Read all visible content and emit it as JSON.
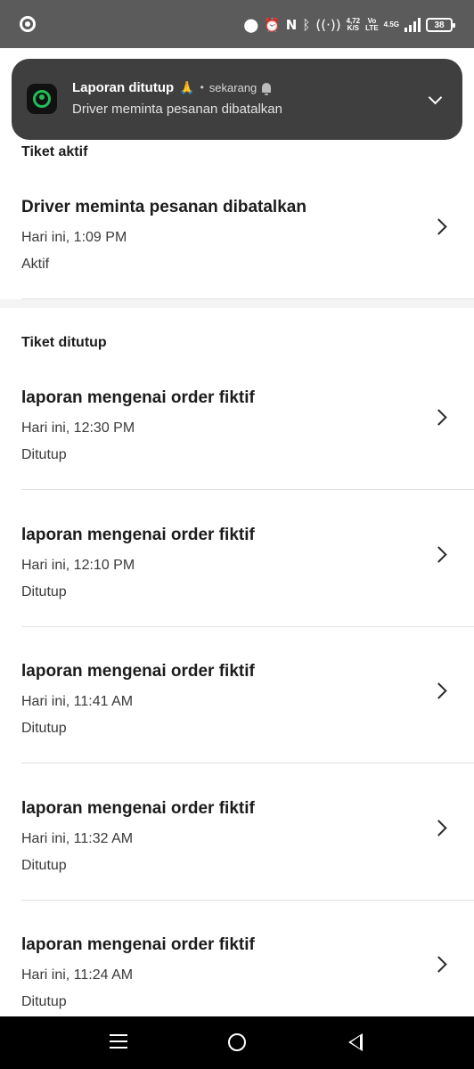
{
  "status_bar": {
    "net_speed_value": "4,72",
    "net_speed_unit": "K/S",
    "volte_top": "Vo",
    "volte_bottom": "LTE",
    "network_type": "4.5G",
    "battery_level": "38",
    "icons": [
      "location-icon",
      "alarm-icon",
      "nfc-icon",
      "bluetooth-icon",
      "hotspot-icon",
      "signal-icon",
      "battery-icon"
    ]
  },
  "notification": {
    "title": "Laporan ditutup",
    "emoji": "🙏",
    "separator": "•",
    "time": "sekarang",
    "body": "Driver meminta pesanan dibatalkan"
  },
  "sections": {
    "active_header": "Tiket aktif",
    "closed_header": "Tiket ditutup"
  },
  "active_tickets": [
    {
      "title": "Driver meminta pesanan dibatalkan",
      "date": "Hari ini, 1:09 PM",
      "status": "Aktif"
    }
  ],
  "closed_tickets": [
    {
      "title": "laporan mengenai order fiktif",
      "date": "Hari ini, 12:30 PM",
      "status": "Ditutup"
    },
    {
      "title": "laporan mengenai order fiktif",
      "date": "Hari ini, 12:10 PM",
      "status": "Ditutup"
    },
    {
      "title": "laporan mengenai order fiktif",
      "date": "Hari ini, 11:41 AM",
      "status": "Ditutup"
    },
    {
      "title": "laporan mengenai order fiktif",
      "date": "Hari ini, 11:32 AM",
      "status": "Ditutup"
    },
    {
      "title": "laporan mengenai order fiktif",
      "date": "Hari ini, 11:24 AM",
      "status": "Ditutup"
    }
  ],
  "colors": {
    "status_bar_bg": "#5b5b5b",
    "notification_bg": "#3f3f3f",
    "app_icon_accent": "#1fbf57",
    "nav_bar_bg": "#000000",
    "text_primary": "#1c1c1c"
  }
}
